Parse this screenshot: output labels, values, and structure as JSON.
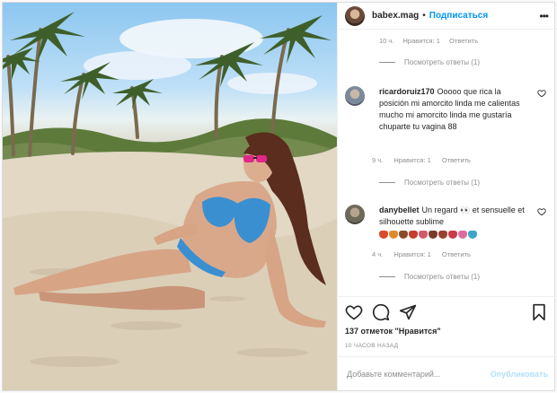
{
  "header": {
    "username": "babex.mag",
    "separator": "•",
    "follow_label": "Подписаться",
    "more_label": "•••"
  },
  "partial_comment": {
    "time": "10 ч.",
    "likes": "Нравится: 1",
    "reply": "Ответить",
    "view_replies": "Посмотреть ответы (1)"
  },
  "comments": [
    {
      "username": "ricardoruiz170",
      "text": "Ooooo que rica la posición mi amorcito linda me calientas mucho mi amorcito linda me gustaría chuparte tu vagina 88",
      "time": "9 ч.",
      "likes": "Нравится: 1",
      "reply": "Ответить",
      "view_replies": "Посмотреть ответы (1)"
    },
    {
      "username": "danybellet",
      "text": "Un regard 👀 et sensuelle et silhouette sublime",
      "time": "4 ч.",
      "likes": "Нравится: 1",
      "reply": "Ответить",
      "view_replies": "Посмотреть ответы (1)"
    }
  ],
  "emoji_colors": [
    "#d94b2b",
    "#e08a2c",
    "#8a4b2a",
    "#c63b2c",
    "#d05a6a",
    "#7a3b2a",
    "#9a4030",
    "#c83a4a",
    "#e06aa0",
    "#3aa6c8"
  ],
  "actions": {
    "like_icon": "heart-icon",
    "comment_icon": "comment-icon",
    "share_icon": "share-icon",
    "save_icon": "bookmark-icon"
  },
  "likes_text": "137 отметок \"Нравится\"",
  "timestamp": "10 ЧАСОВ НАЗАД",
  "add_comment": {
    "placeholder": "Добавьте комментарий...",
    "publish_label": "Опубликовать"
  },
  "colors": {
    "accent": "#0095f6",
    "publish_disabled": "#b2dffc",
    "muted": "#8e8e8e"
  }
}
